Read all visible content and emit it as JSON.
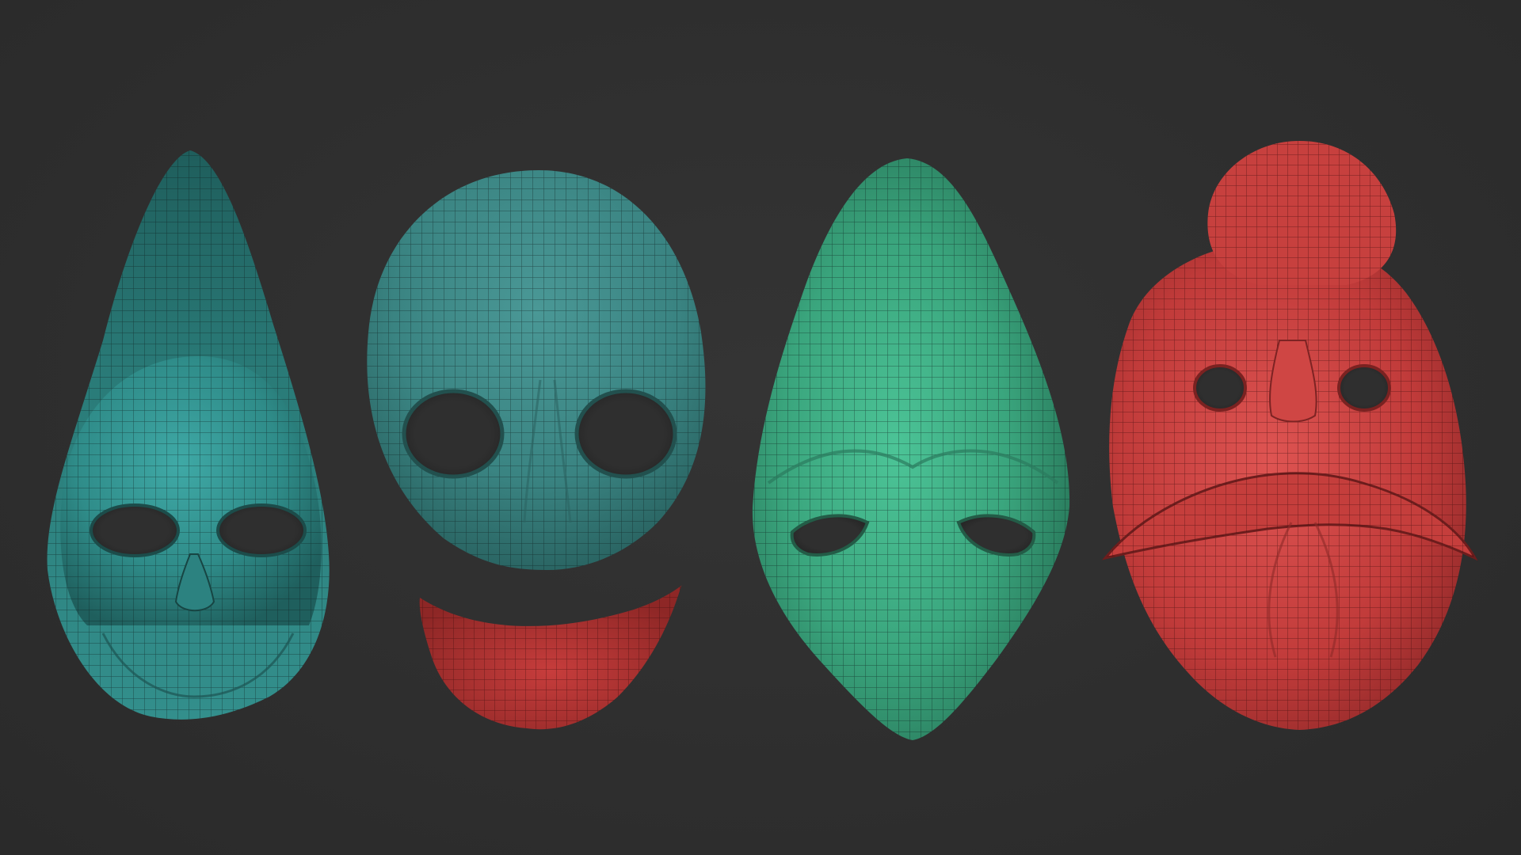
{
  "scene": {
    "background_color": "#2f2f2f",
    "wire_color": "#0d1a1a",
    "objects": [
      {
        "name": "tall-teal-mask",
        "color": "#2f8f8c"
      },
      {
        "name": "round-teal-mask",
        "color": "#3a8a88"
      },
      {
        "name": "red-mouth-piece",
        "color": "#c23a39"
      },
      {
        "name": "green-pointed-mask",
        "color": "#3fae86"
      },
      {
        "name": "red-beaked-mask",
        "color": "#c8413f"
      }
    ]
  }
}
